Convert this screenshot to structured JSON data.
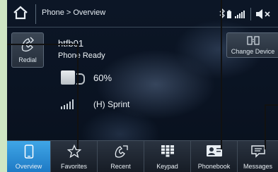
{
  "header": {
    "breadcrumb": "Phone > Overview",
    "home_icon": "home-icon"
  },
  "left_panel": {
    "redial_label": "Redial",
    "redial_icon": "phone-redial-icon"
  },
  "device": {
    "name": "htfb01",
    "status": "Phone Ready",
    "battery_percent": "60%",
    "battery_level": 0.6,
    "carrier": "(H) Sprint"
  },
  "right_panel": {
    "change_device_label": "Change Device",
    "change_device_icon": "change-device-icon"
  },
  "bottom_nav": {
    "tabs": [
      {
        "label": "Overview",
        "icon": "phone-icon",
        "active": true
      },
      {
        "label": "Favorites",
        "icon": "star-icon",
        "active": false
      },
      {
        "label": "Recent",
        "icon": "recent-calls-icon",
        "active": false
      },
      {
        "label": "Keypad",
        "icon": "keypad-icon",
        "active": false
      },
      {
        "label": "Phonebook",
        "icon": "phonebook-icon",
        "active": false
      },
      {
        "label": "Messages",
        "icon": "message-icon",
        "active": false
      }
    ]
  },
  "colors": {
    "active_tab": "#2a8fd8",
    "background": "#0a1322",
    "frame": "#cfe6c4"
  }
}
